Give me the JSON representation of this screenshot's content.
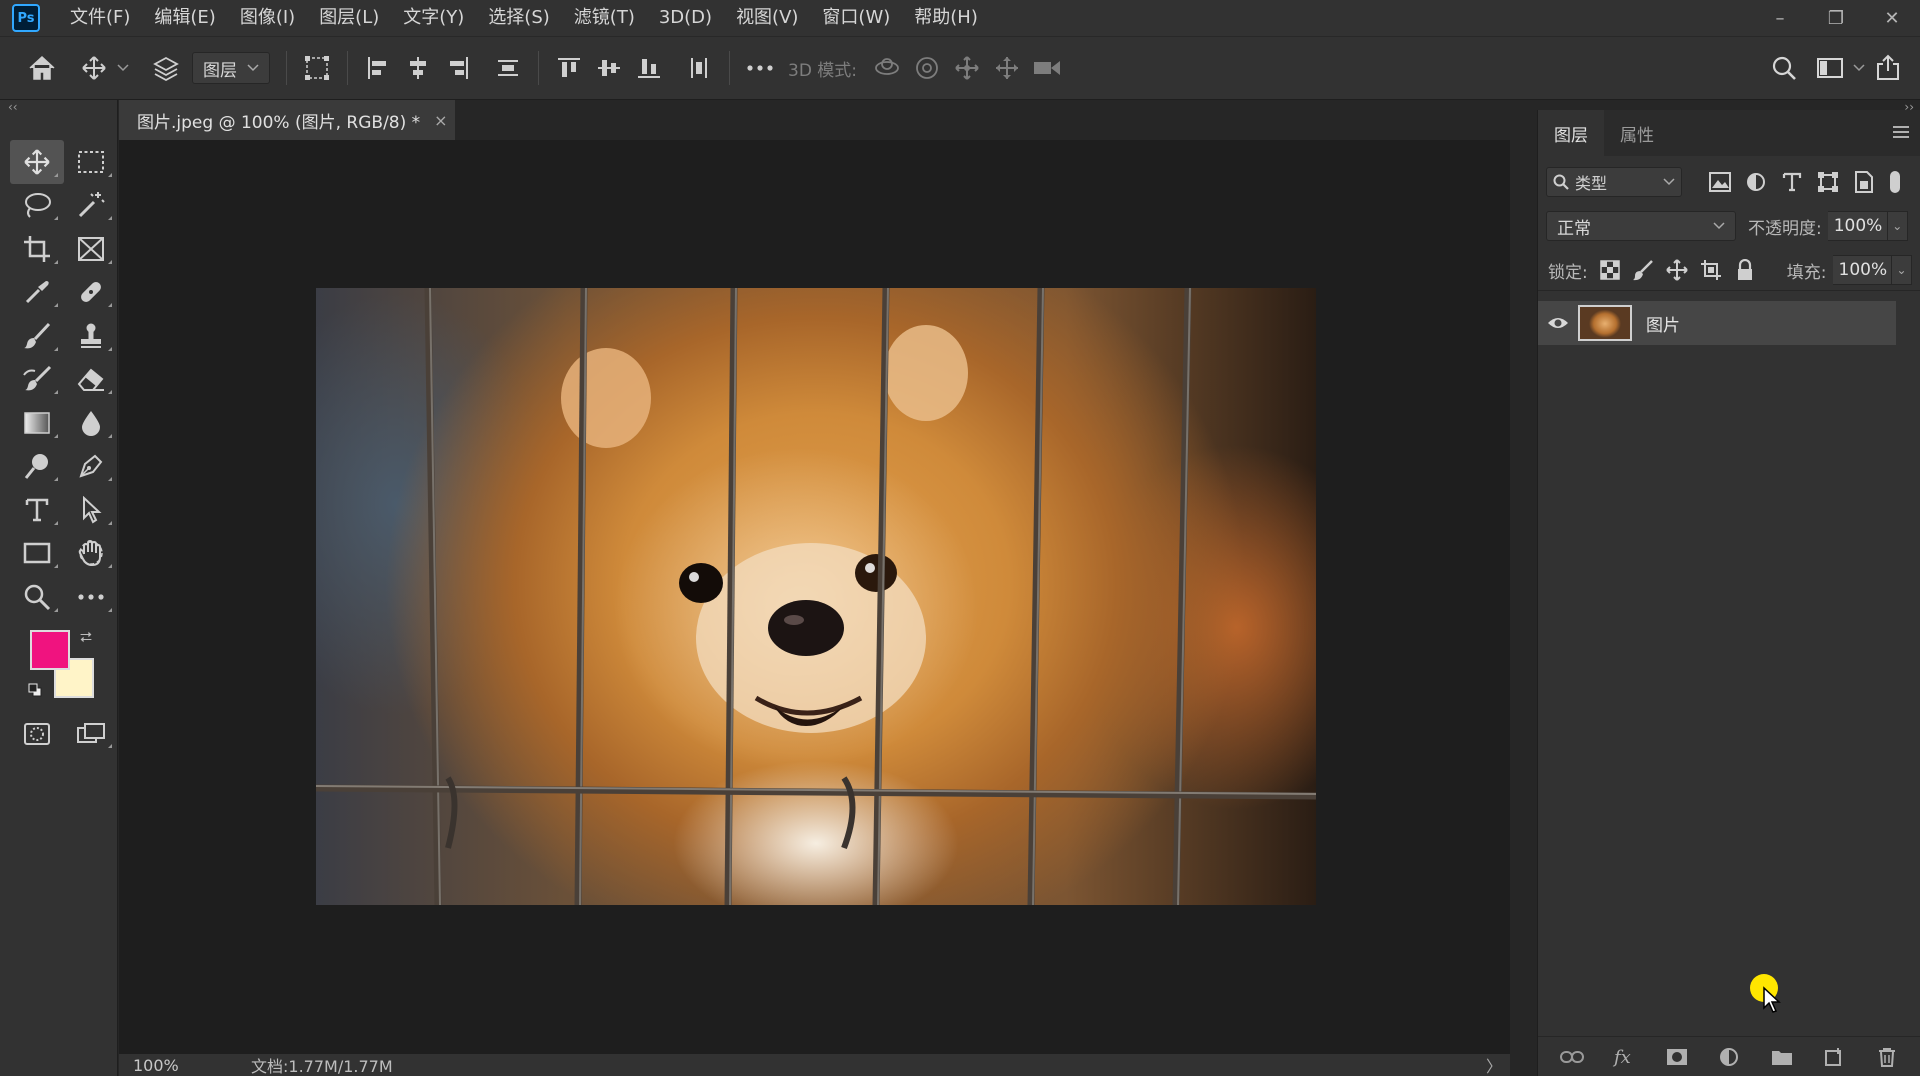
{
  "app": {
    "logo": "Ps"
  },
  "menu": [
    "文件(F)",
    "编辑(E)",
    "图像(I)",
    "图层(L)",
    "文字(Y)",
    "选择(S)",
    "滤镜(T)",
    "3D(D)",
    "视图(V)",
    "窗口(W)",
    "帮助(H)"
  ],
  "window_controls": {
    "minimize": "–",
    "restore": "❐",
    "close": "✕"
  },
  "options_bar": {
    "auto_select_target": "图层",
    "mode_3d_label": "3D 模式:"
  },
  "colors": {
    "foreground": "#f0137f",
    "background": "#fff4c8",
    "accent": "#31a8ff"
  },
  "document": {
    "tab_title": "图片.jpeg @ 100% (图片, RGB/8) *",
    "close_glyph": "×"
  },
  "status": {
    "zoom": "100%",
    "doc_info": "文档:1.77M/1.77M",
    "arrow": "〉"
  },
  "layers_panel": {
    "tabs": [
      "图层",
      "属性"
    ],
    "filter_label": "类型",
    "blend_mode": "正常",
    "opacity_label": "不透明度:",
    "opacity_value": "100%",
    "lock_label": "锁定:",
    "fill_label": "填充:",
    "fill_value": "100%",
    "layers": [
      {
        "name": "图片",
        "visible": true
      }
    ]
  }
}
